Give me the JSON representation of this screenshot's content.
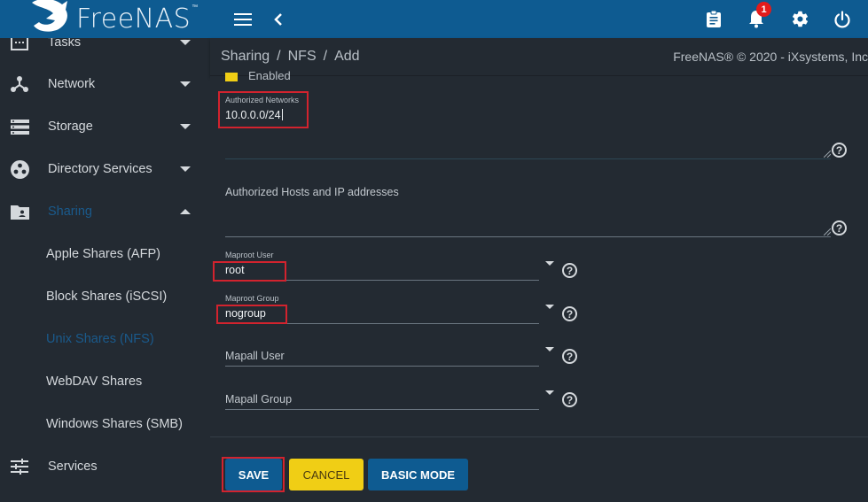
{
  "app": {
    "name": "FreeNAS",
    "trademark": "™"
  },
  "topbar": {
    "menu_icon": "hamburger-icon",
    "back_icon": "chevron-left-icon",
    "actions": [
      {
        "name": "task-manager",
        "icon": "clipboard-icon"
      },
      {
        "name": "notifications",
        "icon": "bell-icon",
        "badge": "1"
      },
      {
        "name": "settings",
        "icon": "gear-icon"
      },
      {
        "name": "power",
        "icon": "power-icon"
      }
    ]
  },
  "sidebar": {
    "items": [
      {
        "label": "Tasks",
        "icon": "calendar-icon",
        "expanded": false
      },
      {
        "label": "Network",
        "icon": "network-icon",
        "expanded": false
      },
      {
        "label": "Storage",
        "icon": "storage-icon",
        "expanded": false
      },
      {
        "label": "Directory Services",
        "icon": "directory-icon",
        "expanded": false
      },
      {
        "label": "Sharing",
        "icon": "shared-folder-icon",
        "expanded": true,
        "active": true
      },
      {
        "label": "Services",
        "icon": "sliders-icon"
      }
    ],
    "sharing_children": [
      {
        "label": "Apple Shares (AFP)"
      },
      {
        "label": "Block Shares (iSCSI)"
      },
      {
        "label": "Unix Shares (NFS)",
        "active": true
      },
      {
        "label": "WebDAV Shares"
      },
      {
        "label": "Windows Shares (SMB)"
      }
    ]
  },
  "breadcrumb": {
    "items": [
      "Sharing",
      "NFS",
      "Add"
    ],
    "separator": "/",
    "copyright": "FreeNAS® © 2020 - iXsystems, Inc"
  },
  "form": {
    "enabled": {
      "label": "Enabled",
      "checked": true
    },
    "authorized_networks": {
      "label": "Authorized Networks",
      "value": "10.0.0.0/24"
    },
    "authorized_hosts": {
      "placeholder": "Authorized Hosts and IP addresses",
      "value": ""
    },
    "maproot_user": {
      "label": "Maproot User",
      "value": "root"
    },
    "maproot_group": {
      "label": "Maproot Group",
      "value": "nogroup"
    },
    "mapall_user": {
      "placeholder": "Mapall User",
      "value": ""
    },
    "mapall_group": {
      "placeholder": "Mapall Group",
      "value": ""
    },
    "help_glyph": "?"
  },
  "buttons": {
    "save": "SAVE",
    "cancel": "CANCEL",
    "basic_mode": "BASIC MODE"
  },
  "colors": {
    "topbar": "#0e5b91",
    "background": "#232a32",
    "primary": "#0e5b91",
    "accent": "#f0ce15",
    "highlight_box": "#d2232e",
    "active_nav": "#1a5a8c",
    "badge": "#e31b1b"
  }
}
